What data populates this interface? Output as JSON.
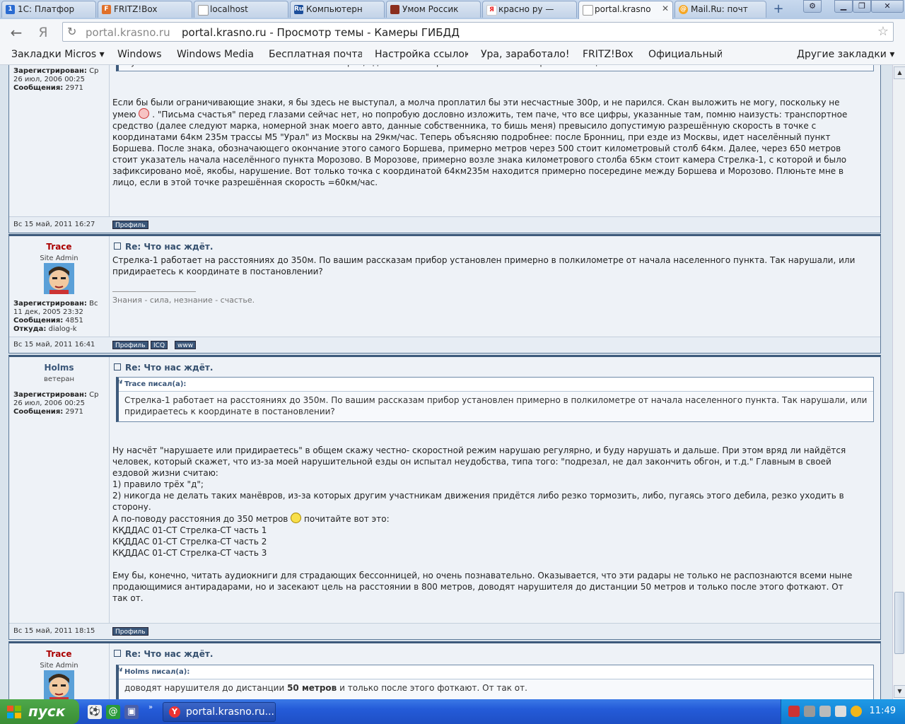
{
  "tabs": [
    {
      "label": "1С: Платфор",
      "icon": "1c-icon"
    },
    {
      "label": "FRITZ!Box",
      "icon": "fritz-icon"
    },
    {
      "label": "localhost",
      "icon": "page-icon"
    },
    {
      "label": "Компьютерн",
      "icon": "ru-icon"
    },
    {
      "label": "Умом Россик",
      "icon": "page-icon"
    },
    {
      "label": "красно ру —",
      "icon": "yandex-icon"
    },
    {
      "label": "portal.krasno",
      "icon": "page-icon"
    },
    {
      "label": "Mail.Ru: почт",
      "icon": "mailru-icon"
    }
  ],
  "address": {
    "host": "portal.krasno.ru",
    "title": "portal.krasno.ru - Просмотр темы - Камеры ГИБДД"
  },
  "bookmarks": [
    "Закладки Micros ▾",
    "Windows",
    "Windows Media",
    "Бесплатная почта",
    "Настройка ссылок",
    "Ура, заработало!",
    "FRITZ!Box",
    "Официальный сай",
    "Другие закладки ▾"
  ],
  "posts": [
    {
      "author": {
        "info": [
          [
            "Зарегистрирован:",
            "Ср 26 июл, 2006 00:25"
          ],
          [
            "Сообщения:",
            "2971"
          ]
        ]
      },
      "quote": "Ну так выложите скан или покажите место на карте, где стоит камера. Может там были ограничивающие знаки?",
      "text_before": "Если бы были ограничивающие знаки, я бы здесь не выступал, а молча проплатил бы эти несчастные 300р, и не парился. Скан выложить не могу, поскольку не\nумею",
      "text_after": " . \"Письма счастья\" перед глазами сейчас нет, но попробую дословно изложить, тем паче, что все цифры, указанные там, помню наизусть: транспортное\nсредство (далее следуют марка, номерной знак моего авто, данные собственника, то бишь меня) превысило допустимую разрешённую скорость в точке с\nкоординатами 64км 235м трассы М5 \"Урал\" из Москвы на 29км/час. Теперь объясняю подробнее: после Бронниц, при езде из Москвы, идет населённый пункт\nБоршева. После знака, обозначающего окончание этого самого Боршева, примерно метров через 500 стоит километровый столб 64км. Далее, через 650 метров\nстоит указатель начала населённого пункта Морозово. В Морозове, примерно возле знака километрового столба 65км стоит камера Стрелка-1, с которой и было\nзафиксировано моё, якобы, нарушение. Вот только точка с координатой 64км235м находится примерно посередине между Боршева и Морозово. Плюньте мне в\nлицо, если в этой точке разрешённая скорость =60км/час.",
      "date": "Вс 15 май, 2011 16:27",
      "buttons": [
        "Профиль"
      ]
    },
    {
      "author": {
        "name": "Trace",
        "rank": "Site Admin",
        "info": [
          [
            "Зарегистрирован:",
            "Вс 11 дек, 2005 23:32"
          ],
          [
            "Сообщения:",
            "4851"
          ],
          [
            "Откуда:",
            "dialog-k"
          ]
        ]
      },
      "title": "Re: Что нас ждёт.",
      "text": "Стрелка-1 работает на расстояниях до 350м. По вашим рассказам прибор установлен примерно в полкилометре от начала населенного пункта. Так нарушали, или\nпридираетесь к координате в постановлении?",
      "signature": "Знания - сила, незнание - счастье.",
      "date": "Вс 15 май, 2011 16:41",
      "buttons": [
        "Профиль",
        "ICQ",
        "www"
      ]
    },
    {
      "author": {
        "name": "Holms",
        "rank": "ветеран",
        "info": [
          [
            "Зарегистрирован:",
            "Ср 26 июл, 2006 00:25"
          ],
          [
            "Сообщения:",
            "2971"
          ]
        ]
      },
      "title": "Re: Что нас ждёт.",
      "quote_author": "Trace писал(а):",
      "quote": "Стрелка-1 работает на расстояниях до 350м. По вашим рассказам прибор установлен примерно в полкилометре от начала населенного пункта. Так нарушали, или придираетесь к координате в постановлении?",
      "text1": "Ну насчёт \"нарушаете или придираетесь\" в общем скажу честно- скоростной режим нарушаю регулярно, и буду нарушать и дальше. При этом вряд ли найдётся\nчеловек, который скажет, что из-за моей нарушительной езды он испытал неудобства, типа того: \"подрезал, не дал закончить обгон, и т.д.\" Главным в своей\nездовой жизни считаю:\n1) правило трёх \"д\";\n2) никогда не делать таких манёвров, из-за которых другим участникам движения придётся либо резко тормозить, либо, пугаясь этого дебила, резко уходить в\nсторону.",
      "text2a": "А по-поводу расстояния до 350 метров",
      "text2b": " почитайте вот это:",
      "text3": "КҚДДАС 01-СТ Стрелка-СТ часть 1\nКҚДДАС 01-СТ Стрелка-СТ часть 2\nКҚДДАС 01-СТ Стрелка-СТ часть 3\n\nЕму бы, конечно, читать аудиокниги для страдающих бессонницей, но очень познавательно. Оказывается, что эти радары не только не распознаются всеми ныне\nпродающимися антирадарами, но и засекают цель на расстоянии в 800 метров, доводят нарушителя до дистанции 50 метров и только после этого фоткают. От\nтак от.",
      "date": "Вс 15 май, 2011 18:15",
      "buttons": [
        "Профиль"
      ]
    },
    {
      "author": {
        "name": "Trace",
        "rank": "Site Admin"
      },
      "title": "Re: Что нас ждёт.",
      "quote_author": "Holms писал(а):",
      "quote_a": "доводят нарушителя до дистанции ",
      "quote_b": "50 метров",
      "quote_c": " и только после этого фоткают. От так от."
    }
  ],
  "taskbar": {
    "start": "пуск",
    "task": "portal.krasno.ru...",
    "clock": "11:49"
  },
  "colors": {
    "admin": "#aa0000",
    "accent": "#3d5a7b"
  }
}
